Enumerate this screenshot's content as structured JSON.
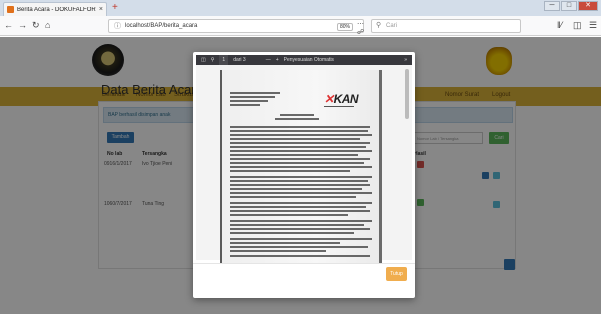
{
  "browser": {
    "tab_title": "Berita Acara - DOKUFALFOR",
    "tab_close": "×",
    "new_tab": "+",
    "url": "localhost/BAP/berita_acara",
    "zoom": "80%",
    "search_placeholder": "Cari",
    "win_min": "─",
    "win_max": "□",
    "win_close": "✕"
  },
  "page": {
    "title": "Data Berita Acara P",
    "menu": [
      "Beranda",
      "Nomor Lab",
      "Struktur",
      "Nomor Surat",
      "Logout"
    ],
    "alert_text": "BAP berhasil disimpan anak",
    "tambah_label": "Tambah",
    "filter_placeholder": "Nomor Lab / Tersangka",
    "cari_label": "Cari",
    "table": {
      "headers": [
        "No lab",
        "Tersangka",
        "Hasil"
      ],
      "rows": [
        {
          "no_lab": "0916/1/2017",
          "tersangka": "Ivo Tjioe Peni"
        },
        {
          "no_lab": "1060/7/2017",
          "tersangka": "Tuna Ting"
        }
      ]
    }
  },
  "modal": {
    "pdf_page": "1",
    "pdf_of": "dari 3",
    "pdf_zoom": "Penyesuaian Otomatis",
    "kan_x": "✕",
    "kan_text": "KAN",
    "tutup_label": "Tutup"
  },
  "colors": {
    "menubar": "#dbb43a",
    "primary": "#337ab7",
    "success": "#5cb85c",
    "danger": "#d9534f",
    "warning": "#f0ad4e",
    "info": "#5bc0de"
  }
}
